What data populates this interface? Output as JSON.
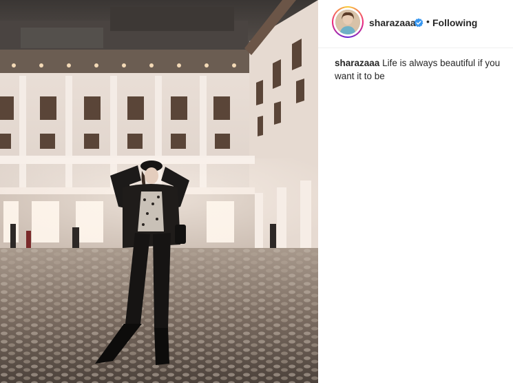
{
  "post": {
    "photo_alt": "Woman in black outfit and cap standing on cobblestones in front of illuminated building",
    "header": {
      "username": "sharazaaa",
      "verified_icon": "verified-badge-icon",
      "separator": "•",
      "follow_label": "Following"
    },
    "caption": {
      "username": "sharazaaa",
      "text": "Life is always beautiful if you want it to be"
    }
  },
  "colors": {
    "accent": "#3897f0",
    "text": "#262626",
    "divider": "#efefef"
  }
}
